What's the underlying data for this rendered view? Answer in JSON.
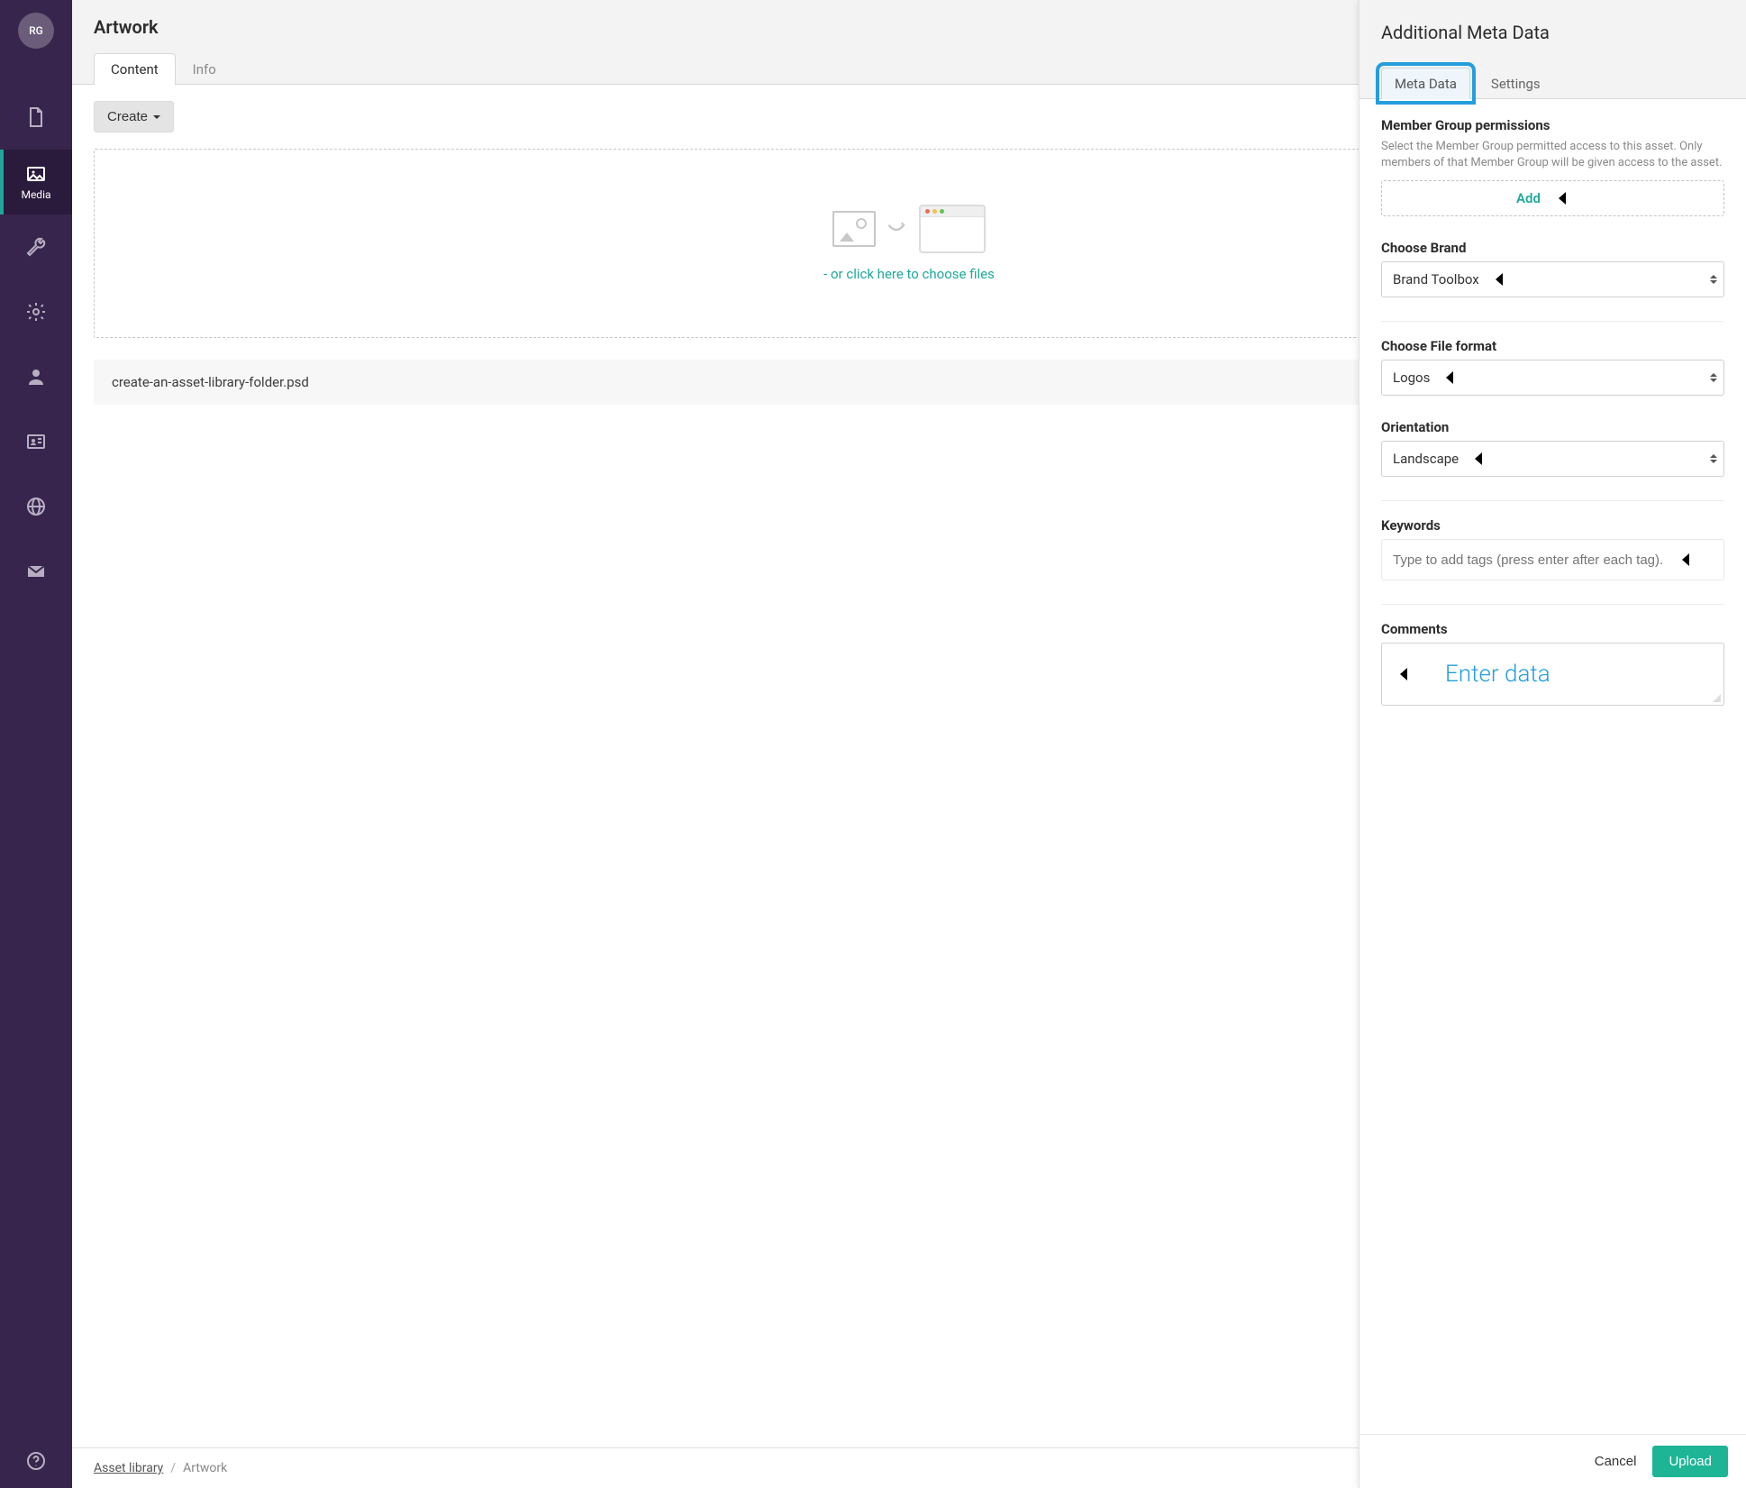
{
  "avatar": {
    "initials": "RG"
  },
  "rail": {
    "media_label": "Media"
  },
  "header": {
    "title": "Artwork",
    "tabs": {
      "content": "Content",
      "info": "Info"
    }
  },
  "toolbar": {
    "create_label": "Create"
  },
  "dropzone": {
    "text": "- or click here to choose files"
  },
  "file_row": {
    "name": "create-an-asset-library-folder.psd"
  },
  "breadcrumb": {
    "root": "Asset library",
    "current": "Artwork"
  },
  "panel": {
    "title": "Additional Meta Data",
    "tabs": {
      "metadata": "Meta Data",
      "settings": "Settings"
    },
    "footer": {
      "cancel": "Cancel",
      "upload": "Upload"
    },
    "sections": {
      "permissions": {
        "title": "Member Group permissions",
        "desc": "Select the Member Group permitted access to this asset. Only members of that Member Group will be given access to the asset.",
        "add_label": "Add"
      },
      "brand": {
        "title": "Choose Brand",
        "value": "Brand Toolbox"
      },
      "format": {
        "title": "Choose File format",
        "value": "Logos"
      },
      "orientation": {
        "title": "Orientation",
        "value": "Landscape"
      },
      "keywords": {
        "title": "Keywords",
        "placeholder": "Type to add tags (press enter after each tag)..."
      },
      "comments": {
        "title": "Comments",
        "hint": "Enter data"
      }
    }
  }
}
